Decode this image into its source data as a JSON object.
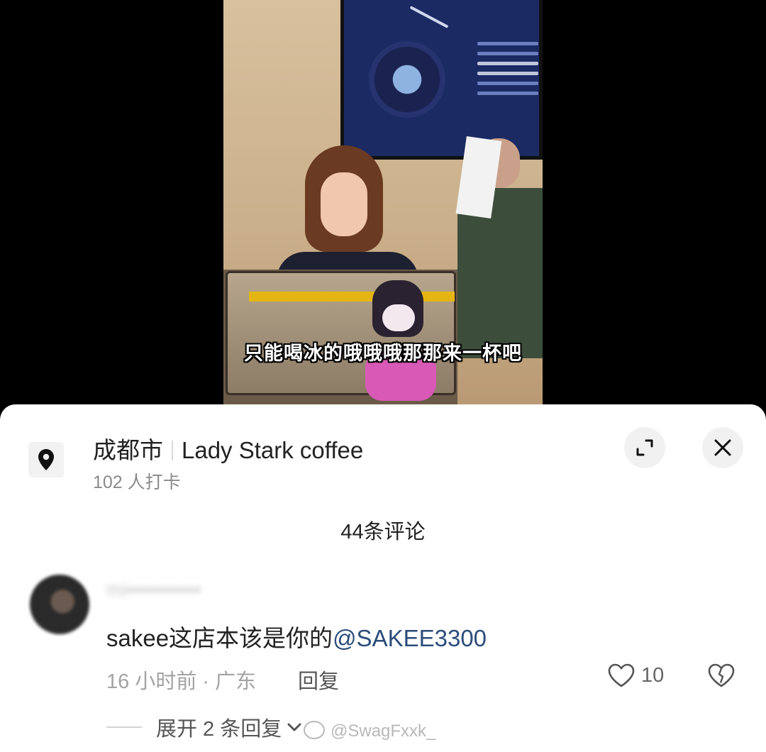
{
  "video": {
    "subtitle": "只能喝冰的哦哦哦那那来一杯吧"
  },
  "location": {
    "city": "成都市",
    "name": "Lady Stark coffee",
    "checkins": "102 人打卡"
  },
  "comments": {
    "count_label": "44条评论",
    "items": [
      {
        "username": "mi▪▪▪▪▪▪▪▪▪▪▪",
        "text": "sakee这店本该是你的",
        "mention": "@SAKEE3300",
        "meta": "16 小时前 · 广东",
        "reply_label": "回复",
        "likes": "10",
        "expand_label": "展开 2 条回复"
      }
    ]
  },
  "watermark": "@SwagFxxk_",
  "colors": {
    "mention": "#2b4c7a",
    "meta": "#a3a3a3",
    "sheet_bg": "#ffffff"
  },
  "icons": [
    "location-pin-icon",
    "expand-icon",
    "close-icon",
    "heart-icon",
    "broken-heart-icon",
    "chevron-down-icon"
  ]
}
